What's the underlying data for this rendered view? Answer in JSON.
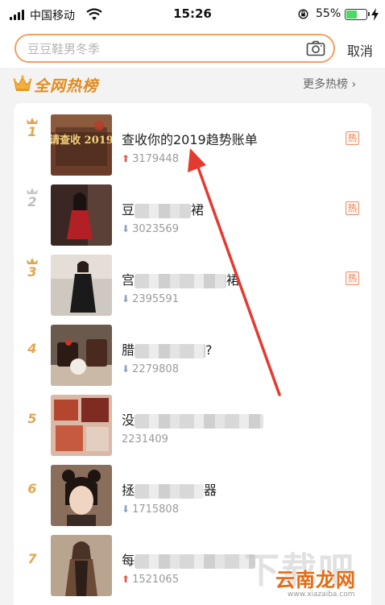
{
  "status_bar": {
    "carrier": "中国移动",
    "time": "15:26",
    "battery_percent": "55%",
    "battery_level": 0.55,
    "icons": [
      "signal-icon",
      "wifi-icon",
      "orientation-lock-icon",
      "battery-icon",
      "charging-icon"
    ]
  },
  "search": {
    "placeholder": "豆豆鞋男冬季",
    "value": "",
    "camera_icon": "camera-icon",
    "cancel_label": "取消"
  },
  "section": {
    "crown_icon": "crown-icon",
    "title": "全网热榜",
    "more_label": "更多热榜 ›"
  },
  "list": {
    "items": [
      {
        "rank": "1",
        "title": "查收你的2019趋势账单",
        "count": "3179448",
        "trend": "up",
        "hot_badge": "热",
        "thumb_text": "请查收 2019"
      },
      {
        "rank": "2",
        "title_prefix": "豆",
        "title_suffix": "裙",
        "count": "3023569",
        "trend": "down",
        "hot_badge": "热"
      },
      {
        "rank": "3",
        "title_prefix": "宫",
        "title_suffix": "裙",
        "count": "2395591",
        "trend": "down",
        "hot_badge": "热"
      },
      {
        "rank": "4",
        "title_prefix": "腊",
        "title_suffix": "?",
        "count": "2279808",
        "trend": "down",
        "hot_badge": ""
      },
      {
        "rank": "5",
        "title_prefix": "没",
        "title_suffix": "",
        "count": "2231409",
        "trend": "none",
        "hot_badge": ""
      },
      {
        "rank": "6",
        "title_prefix": "拯",
        "title_suffix": "器",
        "count": "1715808",
        "trend": "down",
        "hot_badge": ""
      },
      {
        "rank": "7",
        "title_prefix": "每",
        "title_suffix": "",
        "count": "1521065",
        "trend": "up",
        "hot_badge": ""
      }
    ]
  },
  "colors": {
    "accent": "#e28a1e",
    "search_border": "#f2a05e",
    "trend_up": "#e2584e",
    "trend_down": "#8fa2bf",
    "annotation_arrow": "#e53a2f"
  },
  "watermark": {
    "big_text": "下载吧",
    "brand": "云南龙网",
    "url": "www.xiazaiba.com"
  }
}
